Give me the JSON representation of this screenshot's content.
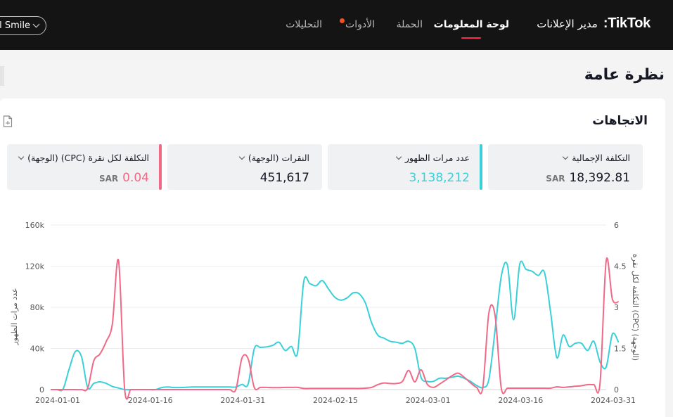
{
  "header": {
    "brand_title": "مدير الإعلانات",
    "brand_logo": "TikTok:",
    "nav": {
      "dashboard": "لوحة المعلومات",
      "campaign": "الحملة",
      "tools": "الأدوات",
      "analytics": "التحليلات"
    },
    "account_label": "l Smile"
  },
  "page": {
    "title": "نظرة عامة",
    "section_title": "الاتجاهات"
  },
  "metrics": [
    {
      "label": "التكلفة الإجمالية",
      "value": "18,392.81",
      "unit": "SAR",
      "color": "#161823"
    },
    {
      "label": "عدد مرات الظهور",
      "value": "3,138,212",
      "unit": "",
      "color": "#3ad0d8"
    },
    {
      "label": "النقرات (الوجهة)",
      "value": "451,617",
      "unit": "",
      "color": "#161823"
    },
    {
      "label": "التكلفة لكل نقرة (CPC) (الوجهة)",
      "value": "0.04",
      "unit": "SAR",
      "color": "#f06a87"
    }
  ],
  "colors": {
    "impressions": "#3ad0d8",
    "cpc": "#f06a87",
    "accent": "#fe2c55"
  },
  "chart_data": {
    "type": "line",
    "ylabel": "عدد مرات الظهور",
    "y2label": "التكلفة لكل نقرة (CPC) (الوجهة)",
    "ylim": [
      0,
      160000
    ],
    "y2lim": [
      0,
      6
    ],
    "yticks": [
      "0",
      "40k",
      "80k",
      "120k",
      "160k"
    ],
    "y2ticks": [
      "0",
      "1.5",
      "3",
      "4.5",
      "6"
    ],
    "xticks": [
      "2024-01-01",
      "2024-01-16",
      "2024-01-31",
      "2024-02-15",
      "2024-03-01",
      "2024-03-16",
      "2024-03-31"
    ],
    "grid": true,
    "series": [
      {
        "axis": "left",
        "points": [
          [
            "2024-01-01",
            0
          ],
          [
            "2024-01-02",
            0
          ],
          [
            "2024-01-03",
            500
          ],
          [
            "2024-01-04",
            20000
          ],
          [
            "2024-01-05",
            37000
          ],
          [
            "2024-01-06",
            32000
          ],
          [
            "2024-01-07",
            2000
          ],
          [
            "2024-01-08",
            6000
          ],
          [
            "2024-01-09",
            7500
          ],
          [
            "2024-01-10",
            6000
          ],
          [
            "2024-01-11",
            3000
          ],
          [
            "2024-01-12",
            1500
          ],
          [
            "2024-01-13",
            0
          ],
          [
            "2024-01-14",
            0
          ],
          [
            "2024-01-15",
            0
          ],
          [
            "2024-01-16",
            0
          ],
          [
            "2024-01-17",
            0
          ],
          [
            "2024-01-18",
            0
          ],
          [
            "2024-01-19",
            2000
          ],
          [
            "2024-01-20",
            2500
          ],
          [
            "2024-01-21",
            2000
          ],
          [
            "2024-01-22",
            2000
          ],
          [
            "2024-01-23",
            2200
          ],
          [
            "2024-01-24",
            2500
          ],
          [
            "2024-01-25",
            2500
          ],
          [
            "2024-01-26",
            2500
          ],
          [
            "2024-01-27",
            2500
          ],
          [
            "2024-01-28",
            2500
          ],
          [
            "2024-01-29",
            2500
          ],
          [
            "2024-01-30",
            2500
          ],
          [
            "2024-01-31",
            2500
          ],
          [
            "2024-02-01",
            5000
          ],
          [
            "2024-02-02",
            5500
          ],
          [
            "2024-02-03",
            40000
          ],
          [
            "2024-02-04",
            41000
          ],
          [
            "2024-02-05",
            41500
          ],
          [
            "2024-02-06",
            43000
          ],
          [
            "2024-02-07",
            46000
          ],
          [
            "2024-02-08",
            38000
          ],
          [
            "2024-02-09",
            42000
          ],
          [
            "2024-02-10",
            36000
          ],
          [
            "2024-02-11",
            105000
          ],
          [
            "2024-02-12",
            103000
          ],
          [
            "2024-02-13",
            101000
          ],
          [
            "2024-02-14",
            106000
          ],
          [
            "2024-02-15",
            98000
          ],
          [
            "2024-02-16",
            90000
          ],
          [
            "2024-02-17",
            87000
          ],
          [
            "2024-02-18",
            89000
          ],
          [
            "2024-02-19",
            94000
          ],
          [
            "2024-02-20",
            93000
          ],
          [
            "2024-02-21",
            84000
          ],
          [
            "2024-02-22",
            65000
          ],
          [
            "2024-02-23",
            53000
          ],
          [
            "2024-02-24",
            50000
          ],
          [
            "2024-02-25",
            47000
          ],
          [
            "2024-02-26",
            46000
          ],
          [
            "2024-02-27",
            45000
          ],
          [
            "2024-02-28",
            47000
          ],
          [
            "2024-02-29",
            40000
          ],
          [
            "2024-03-01",
            12000
          ],
          [
            "2024-03-02",
            8000
          ],
          [
            "2024-03-03",
            8000
          ],
          [
            "2024-03-04",
            11000
          ],
          [
            "2024-03-05",
            11000
          ],
          [
            "2024-03-06",
            12000
          ],
          [
            "2024-03-07",
            13000
          ],
          [
            "2024-03-08",
            11000
          ],
          [
            "2024-03-09",
            8000
          ],
          [
            "2024-03-10",
            4000
          ],
          [
            "2024-03-11",
            2000
          ],
          [
            "2024-03-12",
            10000
          ],
          [
            "2024-03-13",
            58000
          ],
          [
            "2024-03-14",
            110000
          ],
          [
            "2024-03-15",
            121000
          ],
          [
            "2024-03-16",
            68000
          ],
          [
            "2024-03-17",
            122000
          ],
          [
            "2024-03-18",
            117000
          ],
          [
            "2024-03-19",
            115000
          ],
          [
            "2024-03-20",
            111000
          ],
          [
            "2024-03-21",
            114000
          ],
          [
            "2024-03-22",
            75000
          ],
          [
            "2024-03-23",
            31000
          ],
          [
            "2024-03-24",
            53000
          ],
          [
            "2024-03-25",
            42000
          ],
          [
            "2024-03-26",
            45000
          ],
          [
            "2024-03-27",
            45000
          ],
          [
            "2024-03-28",
            38000
          ],
          [
            "2024-03-29",
            47000
          ],
          [
            "2024-03-30",
            27000
          ],
          [
            "2024-03-31",
            22000
          ],
          [
            "2024-04-01",
            54000
          ],
          [
            "2024-04-02",
            46000
          ]
        ]
      },
      {
        "axis": "right",
        "points": [
          [
            "2024-01-01",
            0
          ],
          [
            "2024-01-02",
            0
          ],
          [
            "2024-01-03",
            0
          ],
          [
            "2024-01-04",
            0
          ],
          [
            "2024-01-05",
            0
          ],
          [
            "2024-01-06",
            0
          ],
          [
            "2024-01-07",
            0.05
          ],
          [
            "2024-01-08",
            1.05
          ],
          [
            "2024-01-09",
            1.3
          ],
          [
            "2024-01-10",
            1.75
          ],
          [
            "2024-01-11",
            2.4
          ],
          [
            "2024-01-12",
            4.7
          ],
          [
            "2024-01-13",
            0
          ],
          [
            "2024-01-14",
            0
          ],
          [
            "2024-01-15",
            0
          ],
          [
            "2024-01-16",
            0
          ],
          [
            "2024-01-17",
            0
          ],
          [
            "2024-01-18",
            0
          ],
          [
            "2024-01-19",
            0
          ],
          [
            "2024-01-20",
            0
          ],
          [
            "2024-01-21",
            0
          ],
          [
            "2024-01-22",
            0
          ],
          [
            "2024-01-23",
            0
          ],
          [
            "2024-01-24",
            0
          ],
          [
            "2024-01-25",
            0
          ],
          [
            "2024-01-26",
            0
          ],
          [
            "2024-01-27",
            0
          ],
          [
            "2024-01-28",
            0
          ],
          [
            "2024-01-29",
            0
          ],
          [
            "2024-01-30",
            0
          ],
          [
            "2024-01-31",
            0
          ],
          [
            "2024-02-01",
            1.15
          ],
          [
            "2024-02-02",
            1.12
          ],
          [
            "2024-02-03",
            0.07
          ],
          [
            "2024-02-04",
            0.08
          ],
          [
            "2024-02-05",
            0.08
          ],
          [
            "2024-02-06",
            0.07
          ],
          [
            "2024-02-07",
            0.07
          ],
          [
            "2024-02-08",
            0.08
          ],
          [
            "2024-02-09",
            0.08
          ],
          [
            "2024-02-10",
            0.08
          ],
          [
            "2024-02-11",
            0.04
          ],
          [
            "2024-02-12",
            0.04
          ],
          [
            "2024-02-13",
            0.04
          ],
          [
            "2024-02-14",
            0.04
          ],
          [
            "2024-02-15",
            0.04
          ],
          [
            "2024-02-16",
            0.04
          ],
          [
            "2024-02-17",
            0.04
          ],
          [
            "2024-02-18",
            0.04
          ],
          [
            "2024-02-19",
            0.04
          ],
          [
            "2024-02-20",
            0.04
          ],
          [
            "2024-02-21",
            0.05
          ],
          [
            "2024-02-22",
            0.08
          ],
          [
            "2024-02-23",
            0.18
          ],
          [
            "2024-02-24",
            0.24
          ],
          [
            "2024-02-25",
            0.22
          ],
          [
            "2024-02-26",
            0.22
          ],
          [
            "2024-02-27",
            0.3
          ],
          [
            "2024-02-28",
            0.7
          ],
          [
            "2024-02-29",
            0.28
          ],
          [
            "2024-03-01",
            0.72
          ],
          [
            "2024-03-02",
            0.2
          ],
          [
            "2024-03-03",
            0.08
          ],
          [
            "2024-03-04",
            0.2
          ],
          [
            "2024-03-05",
            0.35
          ],
          [
            "2024-03-06",
            0.5
          ],
          [
            "2024-03-07",
            0.6
          ],
          [
            "2024-03-08",
            0.45
          ],
          [
            "2024-03-09",
            0.25
          ],
          [
            "2024-03-10",
            0.08
          ],
          [
            "2024-03-11",
            0.05
          ],
          [
            "2024-03-12",
            2.8
          ],
          [
            "2024-03-13",
            2.7
          ],
          [
            "2024-03-14",
            0.05
          ],
          [
            "2024-03-15",
            0.05
          ],
          [
            "2024-03-16",
            0.05
          ],
          [
            "2024-03-17",
            0.05
          ],
          [
            "2024-03-18",
            0.05
          ],
          [
            "2024-03-19",
            0.05
          ],
          [
            "2024-03-20",
            0.05
          ],
          [
            "2024-03-21",
            0.05
          ],
          [
            "2024-03-22",
            0.05
          ],
          [
            "2024-03-23",
            0.1
          ],
          [
            "2024-03-24",
            0.08
          ],
          [
            "2024-03-25",
            0.1
          ],
          [
            "2024-03-26",
            0.12
          ],
          [
            "2024-03-27",
            0.14
          ],
          [
            "2024-03-28",
            0.18
          ],
          [
            "2024-03-29",
            0.18
          ],
          [
            "2024-03-30",
            0.22
          ],
          [
            "2024-03-31",
            4.7
          ],
          [
            "2024-04-01",
            3.3
          ],
          [
            "2024-04-02",
            3.2
          ]
        ]
      }
    ]
  }
}
